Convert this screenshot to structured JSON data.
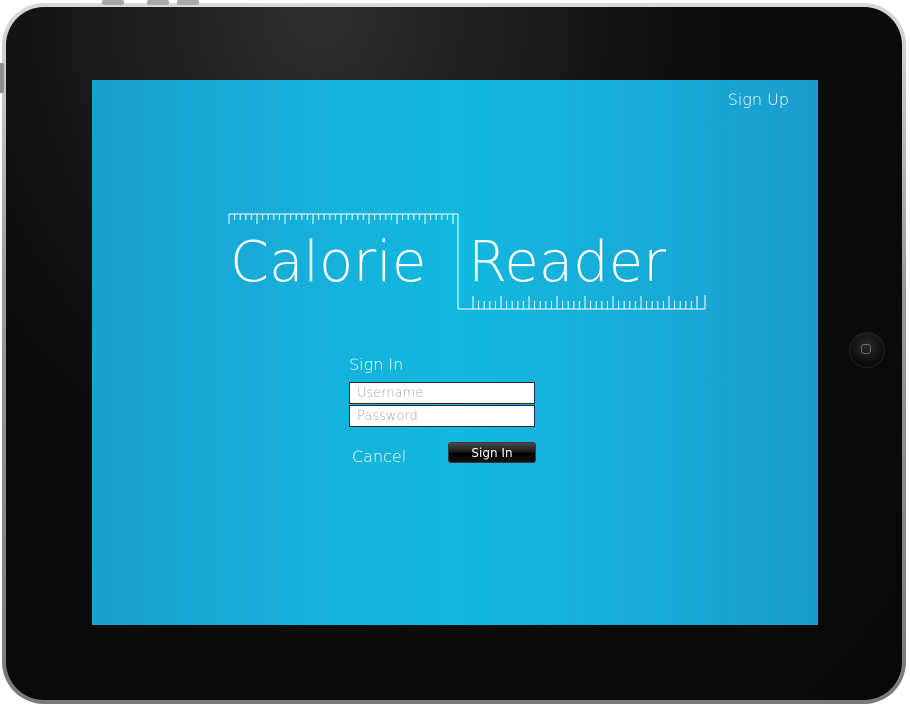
{
  "app": {
    "title": "Calorie Reader",
    "logo_word_1": "Calorie",
    "logo_word_2": "Reader"
  },
  "header": {
    "signup_label": "Sign Up"
  },
  "signin_form": {
    "title": "Sign In",
    "username": {
      "placeholder": "Username",
      "value": ""
    },
    "password": {
      "placeholder": "Password",
      "value": ""
    },
    "cancel_label": "Cancel",
    "submit_label": "Sign In"
  },
  "colors": {
    "screen_background": "#16b0da",
    "text": "#ffffff",
    "button_background": "#000000",
    "device_bezel": "#0d0d0d"
  },
  "icons": {
    "home_button": "home-button-icon",
    "ruler": "ruler-icon"
  }
}
